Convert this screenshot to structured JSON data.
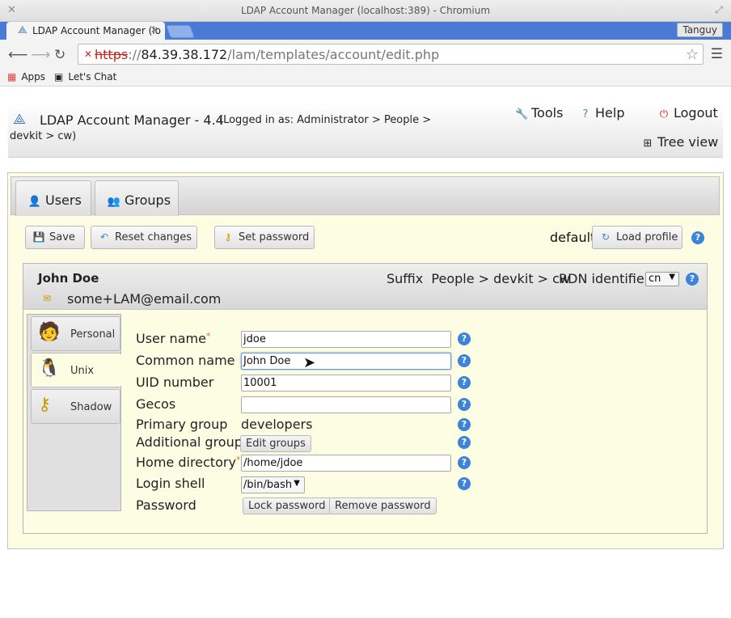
{
  "window": {
    "title": "LDAP Account Manager (localhost:389) - Chromium"
  },
  "browser": {
    "tab_title": "LDAP Account Manager (lo",
    "profile": "Tanguy",
    "url_scheme": "https",
    "url_host": "84.39.38.172",
    "url_path": "/lam/templates/account/edit.php",
    "bookmarks": [
      "Apps",
      "Let's Chat"
    ]
  },
  "header": {
    "app_title": "LDAP Account Manager - 4.4",
    "logged_in_line1": "(Logged in as: Administrator > People >",
    "logged_in_line2": "devkit > cw)",
    "tools": "Tools",
    "help": "Help",
    "logout": "Logout",
    "tree_view": "Tree view"
  },
  "type_tabs": [
    "Users",
    "Groups"
  ],
  "actions": {
    "save": "Save",
    "reset": "Reset changes",
    "set_password": "Set password",
    "profile_name": "default",
    "load_profile": "Load profile"
  },
  "account": {
    "name": "John Doe",
    "email": "some+LAM@email.com",
    "suffix_label": "Suffix",
    "suffix_value": "People > devkit > cw",
    "rdn_label": "RDN identifier",
    "rdn_value": "cn"
  },
  "modules": [
    "Personal",
    "Unix",
    "Shadow"
  ],
  "form": {
    "user_name_label": "User name",
    "user_name": "jdoe",
    "common_name_label": "Common name",
    "common_name": "John Doe",
    "uid_label": "UID number",
    "uid": "10001",
    "gecos_label": "Gecos",
    "gecos": "",
    "primary_group_label": "Primary group",
    "primary_group": "developers",
    "additional_groups_label": "Additional groups",
    "edit_groups": "Edit groups",
    "home_label": "Home directory",
    "home": "/home/jdoe",
    "shell_label": "Login shell",
    "shell": "/bin/bash",
    "password_label": "Password",
    "lock_password": "Lock password",
    "remove_password": "Remove password",
    "required_mark": "*"
  },
  "colors": {
    "accent": "#3d83d6",
    "panel_bg": "#fdfde3",
    "tabstrip": "#4a7ad6"
  }
}
